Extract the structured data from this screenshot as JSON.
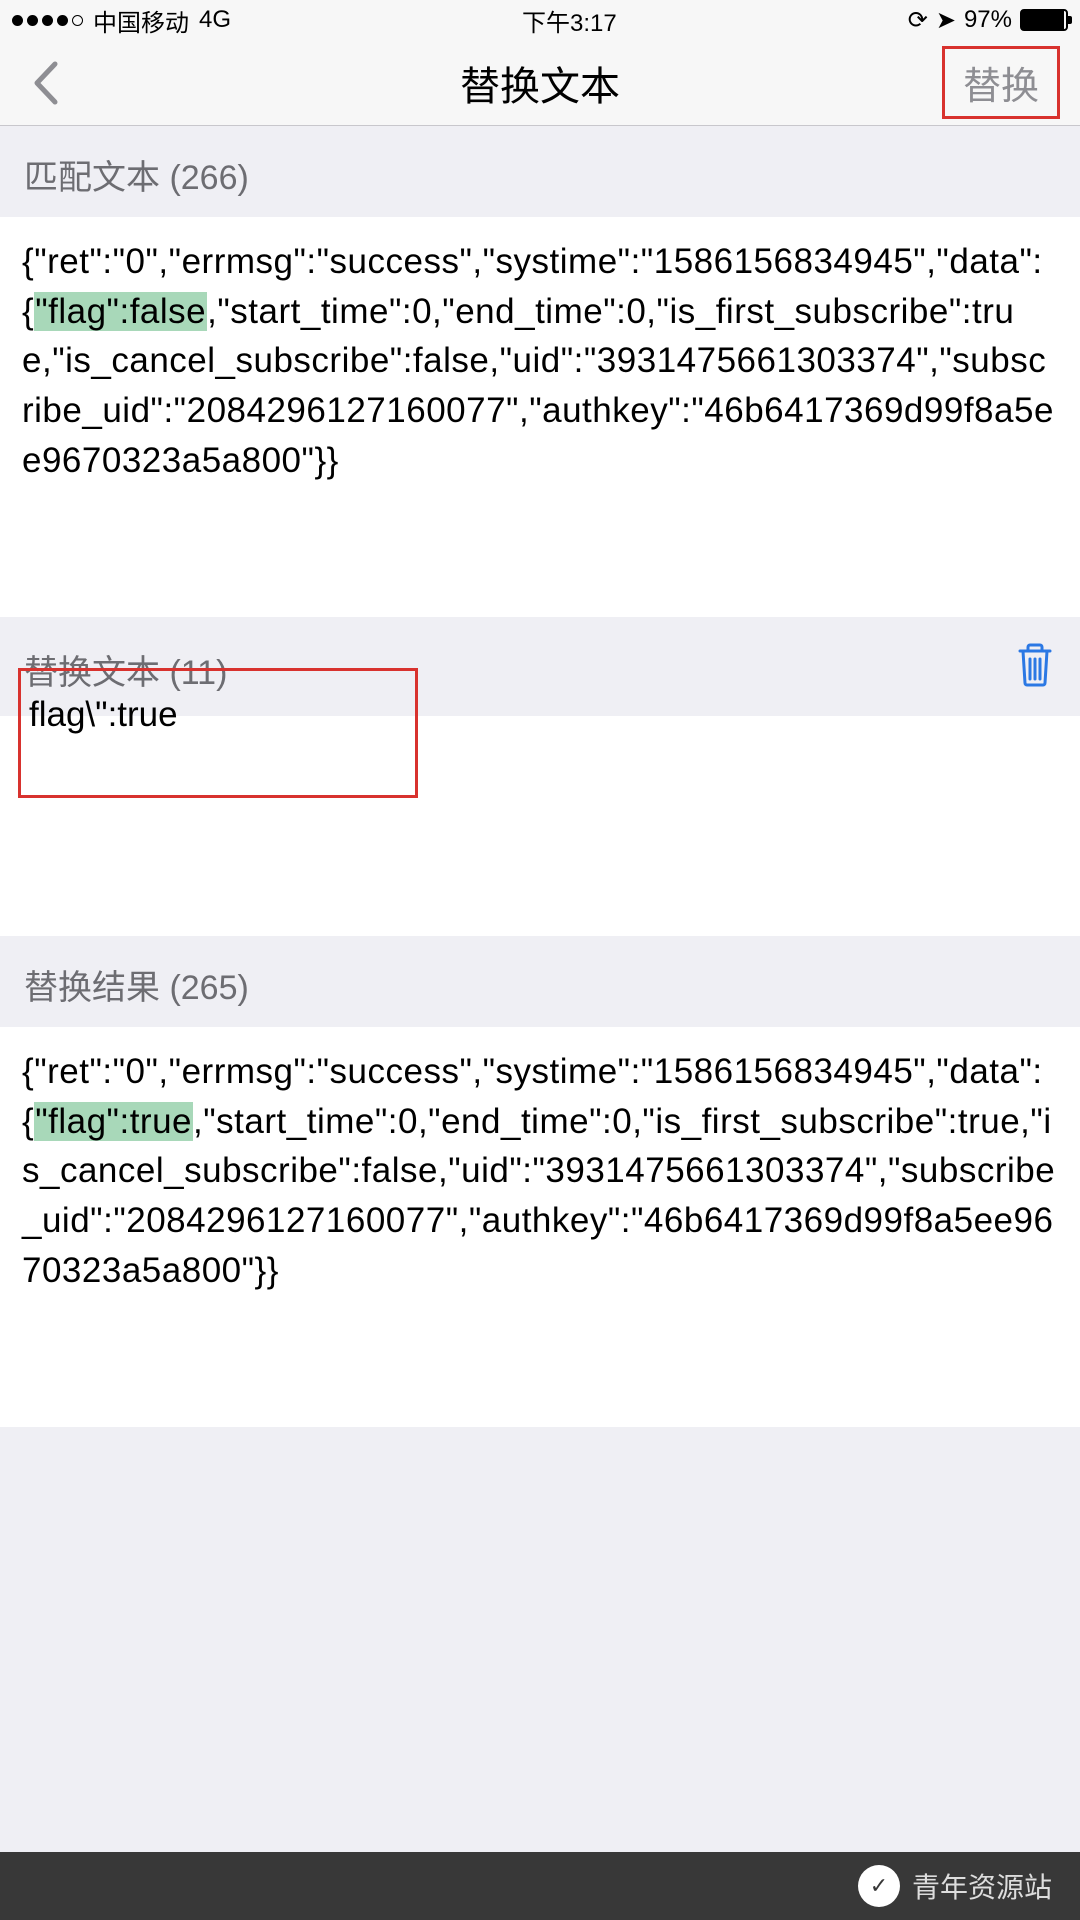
{
  "status": {
    "carrier": "中国移动",
    "network": "4G",
    "time": "下午3:17",
    "battery_pct": "97%"
  },
  "nav": {
    "title": "替换文本",
    "replace_btn": "替换"
  },
  "section1": {
    "header": "匹配文本 (266)",
    "text_before": "{\"ret\":\"0\",\"errmsg\":\"success\",\"systime\":\"1586156834945\",\"data\":{",
    "highlight": "\"flag\":false",
    "text_after": ",\"start_time\":0,\"end_time\":0,\"is_first_subscribe\":true,\"is_cancel_subscribe\":false,\"uid\":\"3931475661303374\",\"subscribe_uid\":\"2084296127160077\",\"authkey\":\"46b6417369d99f8a5ee9670323a5a800\"}}"
  },
  "section2": {
    "header": "替换文本 (11)",
    "input_value": "flag\\\":true"
  },
  "section3": {
    "header": "替换结果 (265)",
    "text_before": "{\"ret\":\"0\",\"errmsg\":\"success\",\"systime\":\"1586156834945\",\"data\":{",
    "highlight": "\"flag\":true",
    "text_after": ",\"start_time\":0,\"end_time\":0,\"is_first_subscribe\":true,\"is_cancel_subscribe\":false,\"uid\":\"3931475661303374\",\"subscribe_uid\":\"2084296127160077\",\"authkey\":\"46b6417369d99f8a5ee9670323a5a800\"}}"
  },
  "footer": {
    "label": "青年资源站"
  }
}
